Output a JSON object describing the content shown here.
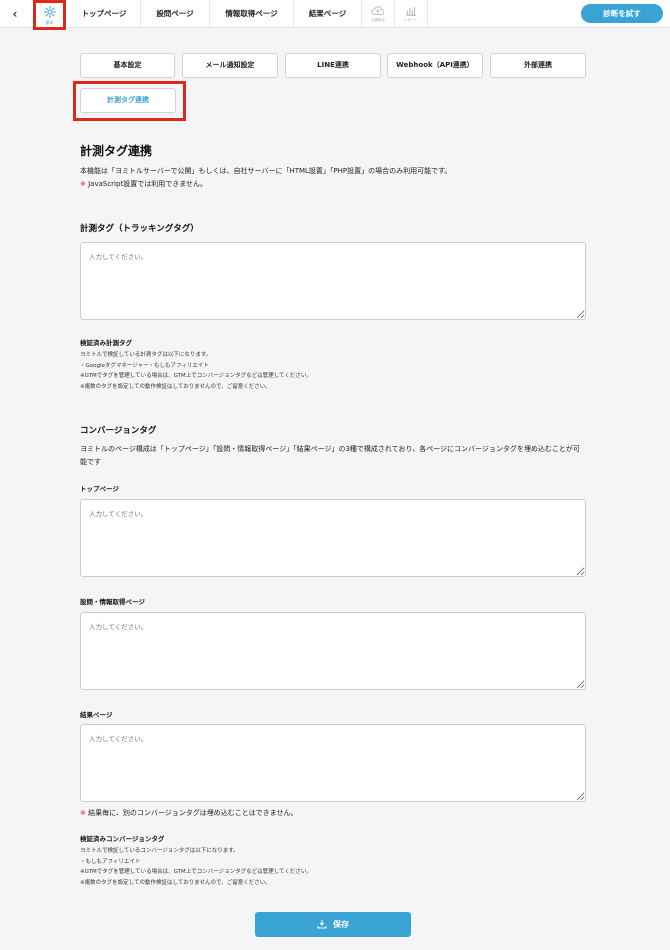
{
  "topbar": {
    "back_icon": "chevron-left-icon",
    "settings_tab": {
      "icon": "gear-icon",
      "label": "基本"
    },
    "nav": [
      "トップページ",
      "設問ページ",
      "情報取得ページ",
      "結果ページ"
    ],
    "icon_tabs": [
      {
        "icon": "cloud-upload-icon",
        "label": "公開設定"
      },
      {
        "icon": "bar-chart-icon",
        "label": "レポート"
      }
    ],
    "try_button": "診断を試す"
  },
  "subtabs": [
    "基本設定",
    "メール通知設定",
    "LINE連携",
    "Webhook（API連携）",
    "外部連携",
    "計測タグ連携"
  ],
  "active_subtab": "計測タグ連携",
  "colors": {
    "accent": "#3aa3d6",
    "highlight": "#e1261c"
  },
  "main": {
    "title": "計測タグ連携",
    "desc1": "本機能は「ヨミトルサーバーで公開」もしくは、自社サーバーに「HTML設置」「PHP設置」の場合のみ利用可能です。",
    "desc2_mark": "※",
    "desc2": " JavaScript設置では利用できません。",
    "tracking": {
      "heading": "計測タグ（トラッキングタグ）",
      "placeholder": "入力してください。"
    },
    "verified_tags": {
      "title": "検証済み計測タグ",
      "lines": [
        "ヨミトルで検証している計測タグは以下になります。",
        "・Googleタグマネージャー・もしもアフィリエイト",
        "※GTMでタグを管理している場合は、GTM上でコンバージョンタグなどは管理してください。",
        "※複数のタグを設定しての動作検証はしておりませんので、ご留意ください。"
      ]
    },
    "conversion": {
      "heading": "コンバージョンタグ",
      "desc": "ヨミトルのページ構成は「トップページ」「設問・情報取得ページ」「結果ページ」の3種で構成されており、各ページにコンバージョンタグを埋め込むことが可能です",
      "fields": [
        {
          "label": "トップページ",
          "placeholder": "入力してください。"
        },
        {
          "label": "設問・情報取得ページ",
          "placeholder": "入力してください。"
        },
        {
          "label": "結果ページ",
          "placeholder": "入力してください。"
        }
      ],
      "note_mark": "※",
      "note": " 結果毎に、別のコンバージョンタグは埋め込むことはできません。"
    },
    "verified_conversion": {
      "title": "検証済みコンバージョンタグ",
      "lines": [
        "ヨミトルで検証しているコンバージョンタグは以下になります。",
        "・もしもアフィリエイト",
        "※GTMでタグを管理している場合は、GTM上でコンバージョンタグなどは管理してください。",
        "※複数のタグを設定しての動作検証はしておりませんので、ご留意ください。"
      ]
    },
    "save_button": {
      "icon": "download-icon",
      "label": "保存"
    }
  }
}
